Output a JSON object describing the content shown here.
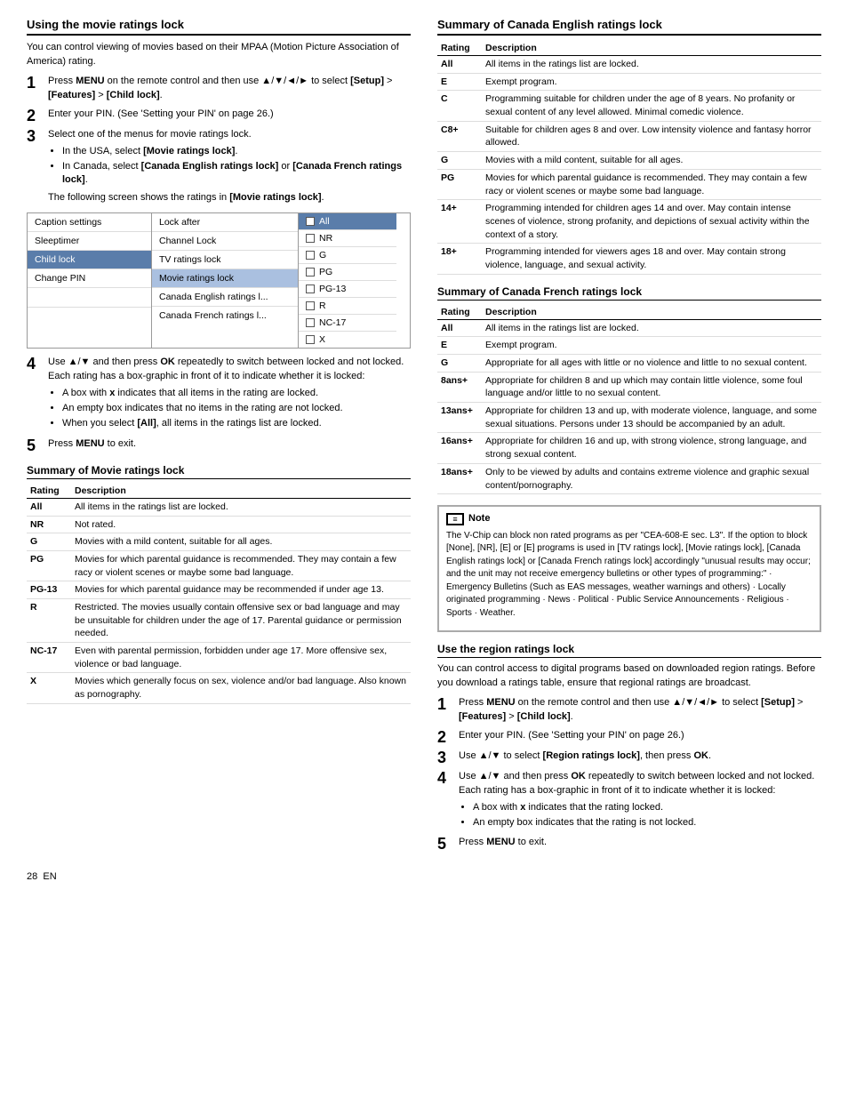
{
  "left": {
    "section1": {
      "title": "Using the movie ratings lock",
      "intro": "You can control viewing of movies based on their MPAA (Motion Picture Association of America) rating.",
      "steps": [
        {
          "text": "Press MENU on the remote control and then use ▲/▼/◄/► to select [Setup] > [Features] > [Child lock].",
          "bold_parts": [
            "MENU",
            "[Setup]",
            "[Features]",
            "[Child lock]"
          ]
        },
        {
          "text": "Enter your PIN. (See 'Setting your PIN' on page 26.)"
        },
        {
          "text": "Select one of the menus for movie ratings lock.",
          "bullets": [
            "In the USA, select [Movie ratings lock].",
            "In Canada, select [Canada English ratings lock] or [Canada French ratings lock]."
          ],
          "after": "The following screen shows the ratings in [Movie ratings lock]."
        }
      ],
      "step4": "Use ▲/▼ and then press OK repeatedly to switch between locked and not locked. Each rating has a box-graphic in front of it to indicate whether it is locked:",
      "step4_bullets": [
        "A box with x indicates that all items in the rating are locked.",
        "An empty box indicates that no items in the rating are not locked.",
        "When you select [All], all items in the ratings list are locked."
      ],
      "step5": "Press MENU to exit."
    },
    "menu_screen": {
      "col1": [
        {
          "label": "Caption settings",
          "state": ""
        },
        {
          "label": "Sleeptimer",
          "state": ""
        },
        {
          "label": "Child lock",
          "state": "selected"
        },
        {
          "label": "Change PIN",
          "state": ""
        }
      ],
      "col2": [
        {
          "label": "Lock after",
          "state": ""
        },
        {
          "label": "Channel Lock",
          "state": ""
        },
        {
          "label": "TV ratings lock",
          "state": ""
        },
        {
          "label": "Movie ratings lock",
          "state": "highlighted"
        },
        {
          "label": "Canada English ratings l...",
          "state": ""
        },
        {
          "label": "Canada French ratings l...",
          "state": ""
        }
      ],
      "col3": [
        {
          "label": "All",
          "checked": false,
          "selected": true
        },
        {
          "label": "NR",
          "checked": false,
          "selected": false
        },
        {
          "label": "G",
          "checked": false,
          "selected": false
        },
        {
          "label": "PG",
          "checked": false,
          "selected": false
        },
        {
          "label": "PG-13",
          "checked": false,
          "selected": false
        },
        {
          "label": "R",
          "checked": false,
          "selected": false
        },
        {
          "label": "NC-17",
          "checked": false,
          "selected": false
        },
        {
          "label": "X",
          "checked": false,
          "selected": false
        }
      ]
    },
    "section2": {
      "title": "Summary of Movie ratings lock",
      "ratings": [
        {
          "rating": "All",
          "description": "All items in the ratings list are locked."
        },
        {
          "rating": "NR",
          "description": "Not rated."
        },
        {
          "rating": "G",
          "description": "Movies with a mild content, suitable for all ages."
        },
        {
          "rating": "PG",
          "description": "Movies for which parental guidance is recommended. They may contain a few racy or violent scenes or maybe some bad language."
        },
        {
          "rating": "PG-13",
          "description": "Movies for which parental guidance may be recommended if under age 13."
        },
        {
          "rating": "R",
          "description": "Restricted. The movies usually contain offensive sex or bad language and may be unsuitable for children under the age of 17. Parental guidance or permission needed."
        },
        {
          "rating": "NC-17",
          "description": "Even with parental permission, forbidden under age 17. More offensive sex, violence or bad language."
        },
        {
          "rating": "X",
          "description": "Movies which generally focus on sex, violence and/or bad language. Also known as pornography."
        }
      ],
      "col_rating": "Rating",
      "col_desc": "Description"
    }
  },
  "right": {
    "section1": {
      "title": "Summary of Canada English ratings lock",
      "col_rating": "Rating",
      "col_desc": "Description",
      "ratings": [
        {
          "rating": "All",
          "description": "All items in the ratings list are locked."
        },
        {
          "rating": "E",
          "description": "Exempt program."
        },
        {
          "rating": "C",
          "description": "Programming suitable for children under the age of 8 years. No profanity or sexual content of any level allowed. Minimal comedic violence."
        },
        {
          "rating": "C8+",
          "description": "Suitable for children ages 8 and over. Low intensity violence and fantasy horror allowed."
        },
        {
          "rating": "G",
          "description": "Movies with a mild content, suitable for all ages."
        },
        {
          "rating": "PG",
          "description": "Movies for which parental guidance is recommended. They may contain a few racy or violent scenes or maybe some bad language."
        },
        {
          "rating": "14+",
          "description": "Programming intended for children ages 14 and over. May contain intense scenes of violence, strong profanity, and depictions of sexual activity within the context of a story."
        },
        {
          "rating": "18+",
          "description": "Programming intended for viewers ages 18 and over. May contain strong violence, language, and sexual activity."
        }
      ]
    },
    "section2": {
      "title": "Summary of Canada French ratings lock",
      "col_rating": "Rating",
      "col_desc": "Description",
      "ratings": [
        {
          "rating": "All",
          "description": "All items in the ratings list are locked."
        },
        {
          "rating": "E",
          "description": "Exempt program."
        },
        {
          "rating": "G",
          "description": "Appropriate for all ages with little or no violence and little to no sexual content."
        },
        {
          "rating": "8ans+",
          "description": "Appropriate for children 8 and up which may contain little violence, some foul language and/or little to no sexual content."
        },
        {
          "rating": "13ans+",
          "description": "Appropriate for children 13 and up, with moderate violence, language, and some sexual situations. Persons under 13 should be accompanied by an adult."
        },
        {
          "rating": "16ans+",
          "description": "Appropriate for children 16 and up, with strong violence, strong language, and strong sexual content."
        },
        {
          "rating": "18ans+",
          "description": "Only to be viewed by adults and contains extreme violence and graphic sexual content/pornography."
        }
      ]
    },
    "note": {
      "label": "Note",
      "text": "The V-Chip can block non rated programs as per \"CEA-608-E sec. L3\". If the option to block [None], [NR], [E] or [E] programs is used in [TV ratings lock], [Movie ratings lock], [Canada English ratings lock] or [Canada French ratings lock] accordingly \"unusual results may occur; and the unit may not receive emergency bulletins or other types of programming:\" · Emergency Bulletins (Such as EAS messages, weather warnings and others) · Locally originated programming · News · Political · Public Service Announcements · Religious · Sports · Weather."
    },
    "section3": {
      "title": "Use the region ratings lock",
      "intro": "You can control access to digital programs based on downloaded region ratings. Before you download a ratings table, ensure that regional ratings are broadcast.",
      "steps": [
        {
          "text": "Press MENU on the remote control and then use ▲/▼/◄/► to select [Setup] > [Features] > [Child lock]."
        },
        {
          "text": "Enter your PIN. (See 'Setting your PIN' on page 26.)"
        },
        {
          "text": "Use ▲/▼ to select [Region ratings lock], then press OK."
        },
        {
          "text": "Use ▲/▼ and then press OK repeatedly to switch between locked and not locked. Each rating has a box-graphic in front of it to indicate whether it is locked:",
          "bullets": [
            "A box with x indicates that the rating locked.",
            "An empty box indicates that the rating is not locked."
          ]
        }
      ],
      "step5": "Press MENU to exit."
    }
  },
  "footer": {
    "page_number": "28",
    "lang": "EN"
  }
}
